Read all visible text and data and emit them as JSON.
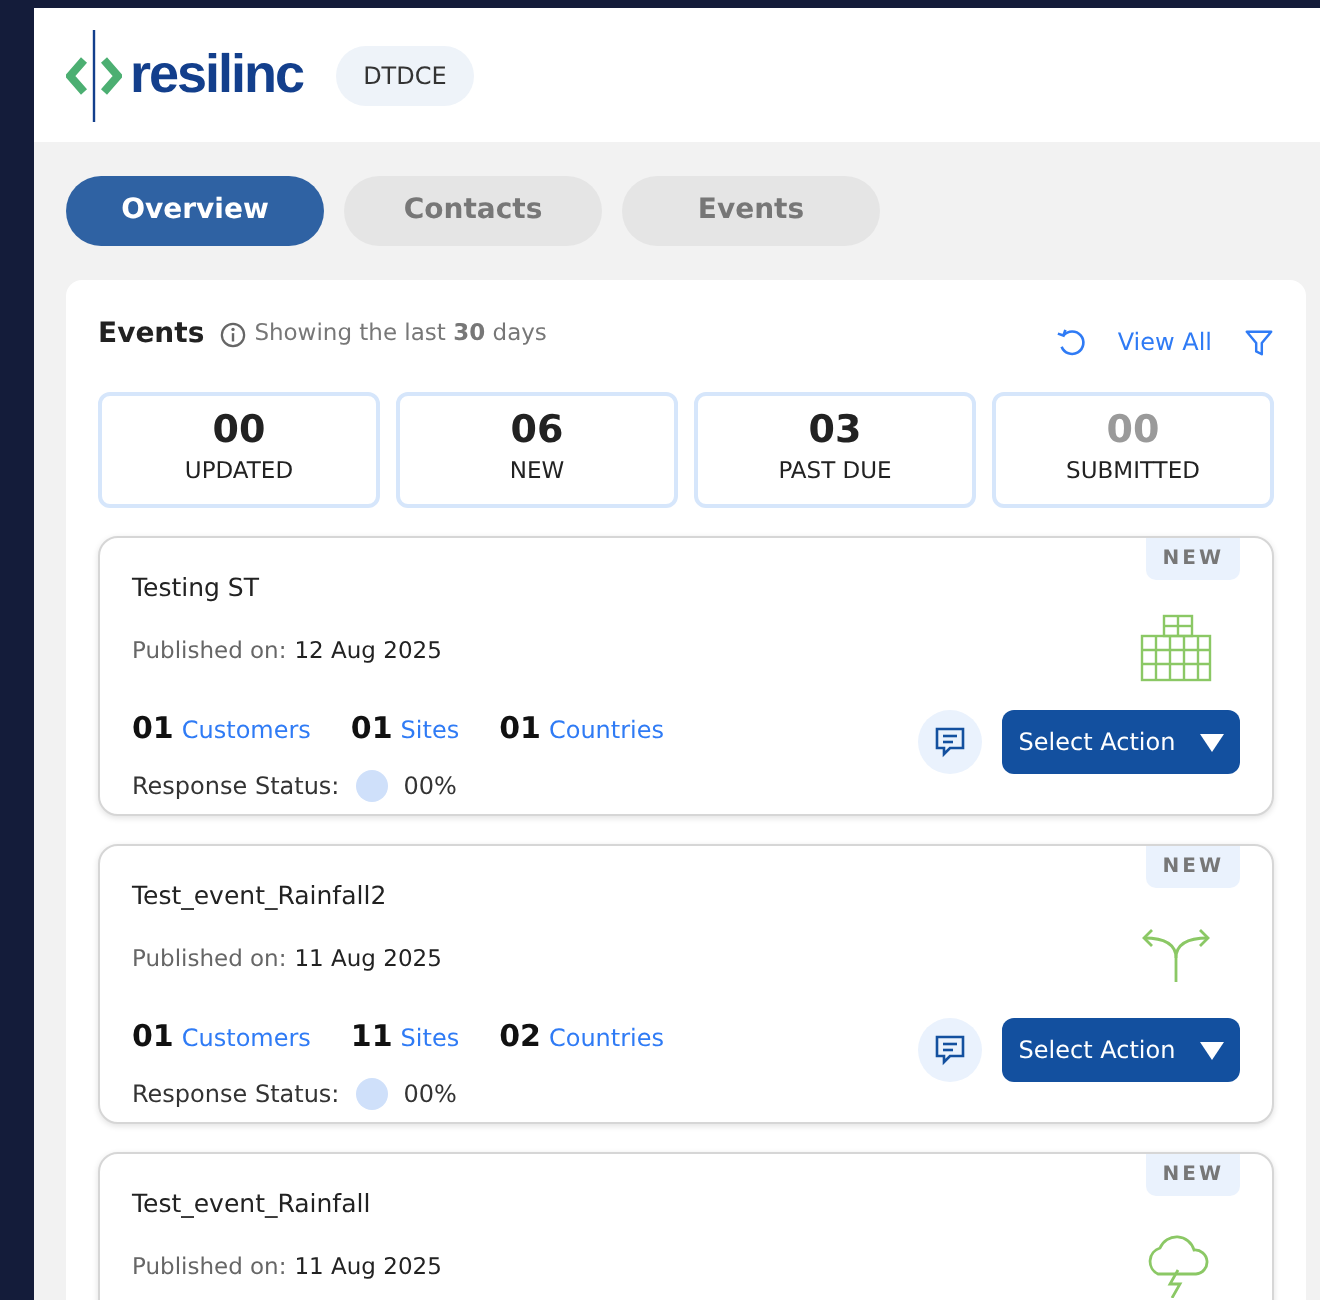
{
  "header": {
    "logo_text": "resilinc",
    "org_badge": "DTDCE"
  },
  "tabs": [
    {
      "label": "Overview",
      "selected": true
    },
    {
      "label": "Contacts",
      "selected": false
    },
    {
      "label": "Events",
      "selected": false
    }
  ],
  "events_panel": {
    "title": "Events",
    "subtitle": "Showing the last **30** days",
    "view_all": "View All",
    "summary": [
      {
        "count": "00",
        "label": "UPDATED",
        "muted": false
      },
      {
        "count": "06",
        "label": "NEW",
        "muted": false
      },
      {
        "count": "03",
        "label": "PAST DUE",
        "muted": false
      },
      {
        "count": "00",
        "label": "SUBMITTED",
        "muted": true
      }
    ],
    "events": [
      {
        "title": "Testing ST",
        "published_label": "Published on:",
        "published_date": "12 Aug 2025",
        "badge": "NEW",
        "kind": "building",
        "counts": [
          {
            "count": "01",
            "name": "Customers"
          },
          {
            "count": "01",
            "name": "Sites"
          },
          {
            "count": "01",
            "name": "Countries"
          }
        ],
        "response_label": "Response Status:",
        "response_value": "00%",
        "action": "Select Action"
      },
      {
        "title": "Test_event_Rainfall2",
        "published_label": "Published on:",
        "published_date": "11 Aug 2025",
        "badge": "NEW",
        "kind": "fork",
        "counts": [
          {
            "count": "01",
            "name": "Customers"
          },
          {
            "count": "11",
            "name": "Sites"
          },
          {
            "count": "02",
            "name": "Countries"
          }
        ],
        "response_label": "Response Status:",
        "response_value": "00%",
        "action": "Select Action"
      },
      {
        "title": "Test_event_Rainfall",
        "published_label": "Published on:",
        "published_date": "11 Aug 2025",
        "badge": "NEW",
        "kind": "storm"
      }
    ]
  }
}
